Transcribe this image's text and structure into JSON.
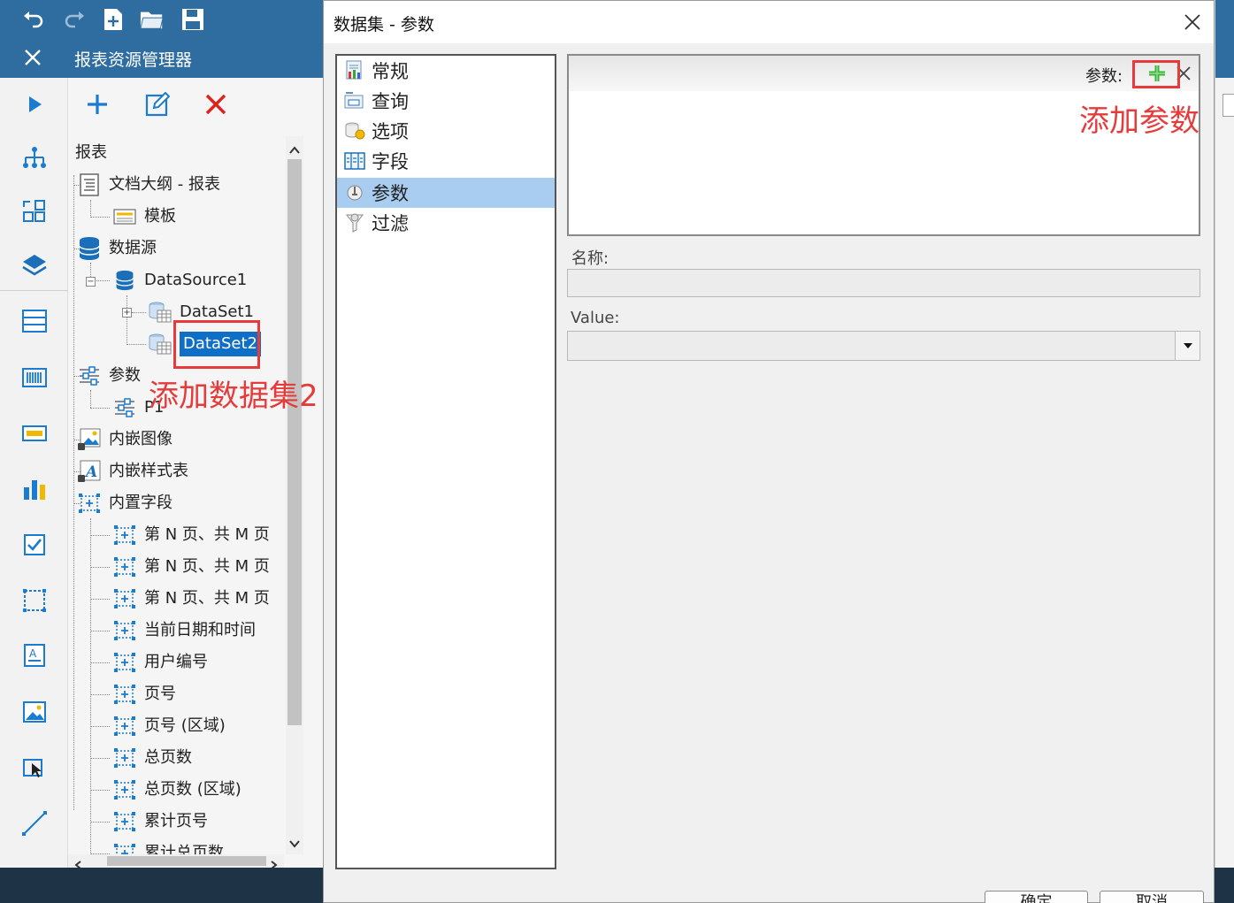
{
  "app": {
    "panel_title": "报表资源管理器"
  },
  "tree": {
    "root": "报表",
    "outline": "文档大纲 - 报表",
    "template": "模板",
    "datasources": "数据源",
    "datasource1": "DataSource1",
    "dataset1": "DataSet1",
    "dataset2": "DataSet2",
    "params": "参数",
    "p1": "P1",
    "embedded_images": "内嵌图像",
    "embedded_styles": "内嵌样式表",
    "builtin_fields": "内置字段",
    "builtin_items": [
      "第 N 页、共 M 页",
      "第 N 页、共 M 页",
      "第 N 页、共 M 页",
      "当前日期和时间",
      "用户编号",
      "页号",
      "页号 (区域)",
      "总页数",
      "总页数 (区域)",
      "累计页号",
      "累计总页数"
    ]
  },
  "annotations": {
    "add_dataset": "添加数据集2",
    "add_param": "添加参数"
  },
  "dialog": {
    "title": "数据集 - 参数",
    "nav": [
      "常规",
      "查询",
      "选项",
      "字段",
      "参数",
      "过滤"
    ],
    "active_nav": "参数",
    "params_label": "参数:",
    "name_label": "名称:",
    "value_label": "Value:",
    "name_value": "",
    "value_value": "",
    "ok_label": "确定",
    "cancel_label": "取消"
  },
  "colors": {
    "title_blue": "#2f6da0",
    "selection_blue": "#0f6fc7",
    "nav_active": "#a8cdf0",
    "annotation_red": "#e53b3b",
    "add_green": "#3cb43c"
  }
}
